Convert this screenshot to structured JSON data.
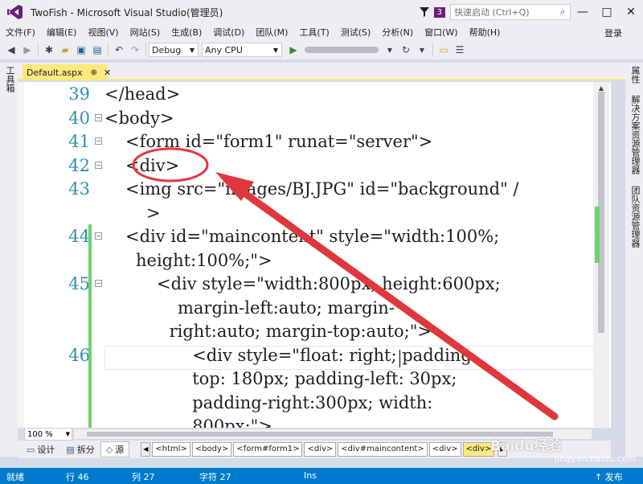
{
  "window": {
    "title": "TwoFish - Microsoft Visual Studio(管理员)",
    "notification_count": "3",
    "quick_launch_placeholder": "快速启动 (Ctrl+Q)",
    "minimize": "—",
    "maximize": "□",
    "close": "✕"
  },
  "menu": {
    "items": [
      "文件(F)",
      "编辑(E)",
      "视图(V)",
      "网站(S)",
      "生成(B)",
      "调试(D)",
      "团队(M)",
      "工具(T)",
      "测试(S)",
      "分析(N)",
      "窗口(W)",
      "帮助(H)"
    ],
    "login": "登录"
  },
  "toolbar": {
    "config": "Debug",
    "platform": "Any CPU"
  },
  "left_strip": {
    "label": "工具箱"
  },
  "right_strip": {
    "labels": [
      "属性",
      "解决方案资源管理器",
      "团队资源管理器"
    ]
  },
  "tab": {
    "label": "Default.aspx",
    "pin": "⊕",
    "close": "✕"
  },
  "editor": {
    "lines": [
      {
        "num": "39",
        "fold": "",
        "text": "</head>",
        "indent": 0,
        "wrap": false
      },
      {
        "num": "40",
        "fold": "−",
        "text": "<body>",
        "indent": 0,
        "wrap": false
      },
      {
        "num": "41",
        "fold": "−",
        "text": "<form id=\"form1\" runat=\"server\">",
        "indent": 1,
        "wrap": false
      },
      {
        "num": "42",
        "fold": "−",
        "text": "<div>",
        "indent": 1,
        "wrap": false
      },
      {
        "num": "43",
        "fold": "",
        "text": "<img src=\"images/BJ.JPG\" id=\"background\" /",
        "indent": 1,
        "wrap": true
      },
      {
        "num": "",
        "fold": "",
        "text": ">",
        "indent": 2,
        "wrap": false
      },
      {
        "num": "44",
        "fold": "−",
        "text": "<div id=\"maincontent\" style=\"width:100%;",
        "indent": 1,
        "wrap": true
      },
      {
        "num": "",
        "fold": "",
        "text": "height:100%;\">",
        "indent": 1.5,
        "wrap": false
      },
      {
        "num": "45",
        "fold": "−",
        "text": "<div style=\"width:800px; height:600px;",
        "indent": 2.5,
        "wrap": true
      },
      {
        "num": "",
        "fold": "",
        "text": "margin-left:auto; margin-",
        "indent": 3.5,
        "wrap": true
      },
      {
        "num": "",
        "fold": "",
        "text": "right:auto; margin-top:auto;\">",
        "indent": 3.1,
        "wrap": false
      },
      {
        "num": "46",
        "fold": "",
        "text": "<div style=\"float: right; padding-",
        "indent": 4.2,
        "wrap": true
      },
      {
        "num": "",
        "fold": "",
        "text": "top: 180px; padding-left: 30px;",
        "indent": 4.2,
        "wrap": true
      },
      {
        "num": "",
        "fold": "",
        "text": "padding-right:300px; width:",
        "indent": 4.2,
        "wrap": true
      },
      {
        "num": "",
        "fold": "",
        "text": "800px;\">",
        "indent": 4.2,
        "wrap": false
      }
    ],
    "wrap_glyph": "↩"
  },
  "zoom": "100 %",
  "view_buttons": [
    "设计",
    "拆分",
    "源"
  ],
  "breadcrumbs": [
    "<html>",
    "<body>",
    "<form#form1>",
    "<div>",
    "<div#maincontent>",
    "<div>",
    "<div>"
  ],
  "status": {
    "ready": "就绪",
    "line": "行 46",
    "col": "列 27",
    "char": "字符 27",
    "ins": "Ins",
    "publish": "↑ 发布"
  },
  "watermark": {
    "main": "Baidu经验",
    "url": "jingyan.baidu.com"
  },
  "colors": {
    "accent": "#68217a",
    "status": "#007acc",
    "annotation": "#e0373d",
    "line_number": "#2b91af"
  }
}
